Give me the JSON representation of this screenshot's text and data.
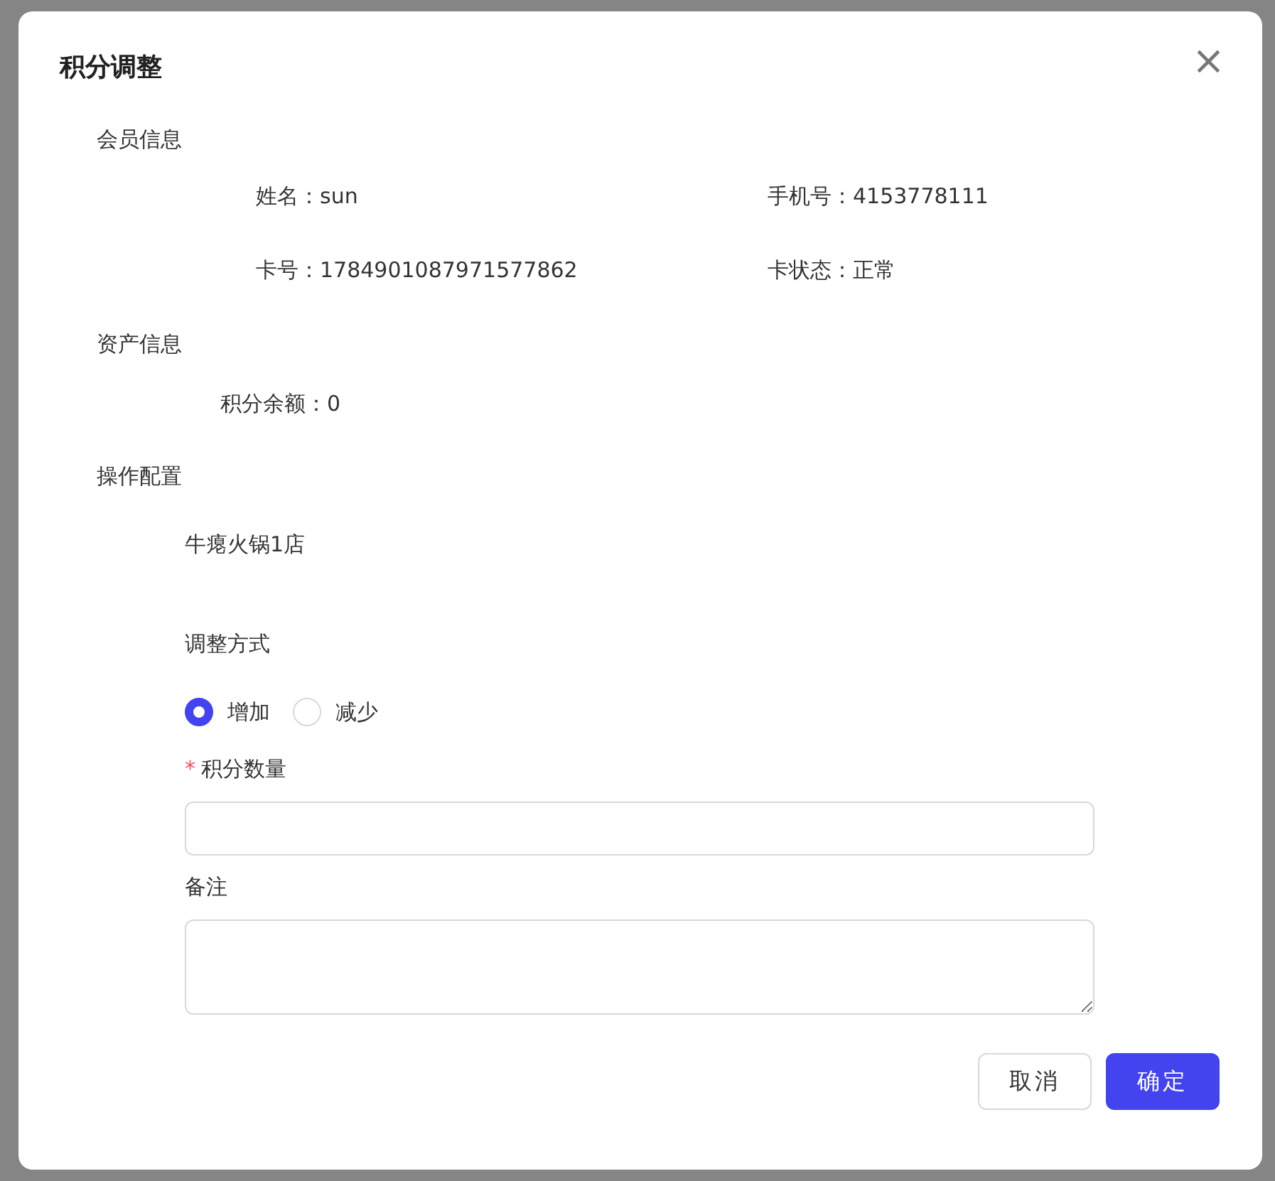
{
  "dialog": {
    "title": "积分调整",
    "close": "×"
  },
  "member_info": {
    "heading": "会员信息",
    "fields": [
      {
        "label": "姓名：",
        "value": "sun"
      },
      {
        "label": "手机号：",
        "value": "4153778111"
      },
      {
        "label": "卡号：",
        "value": "1784901087971577862"
      },
      {
        "label": "卡状态：",
        "value": "正常"
      }
    ]
  },
  "asset_info": {
    "heading": "资产信息",
    "fields": [
      {
        "label": "积分余额：",
        "value": "0"
      }
    ]
  },
  "operation": {
    "heading": "操作配置",
    "store": "牛瘪火锅1店",
    "mode_label": "调整方式",
    "modes": [
      {
        "label": "增加",
        "selected": true
      },
      {
        "label": "减少",
        "selected": false
      }
    ],
    "points": {
      "label": "积分数量",
      "required": true,
      "required_mark": "*"
    },
    "remark": {
      "label": "备注"
    }
  },
  "buttons": [
    {
      "label": "取消",
      "kind": "default"
    },
    {
      "label": "确定",
      "kind": "primary"
    }
  ]
}
